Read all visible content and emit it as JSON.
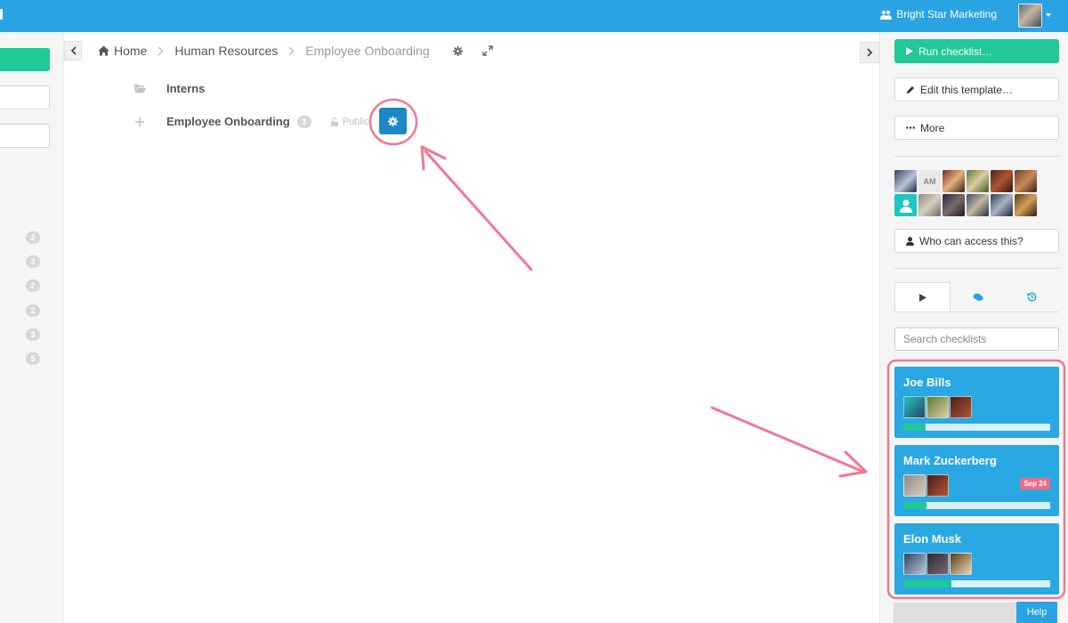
{
  "topbar": {
    "org_name": "Bright Star Marketing",
    "org_icon": "users-icon",
    "accent_color": "#2aa3e3"
  },
  "breadcrumb": {
    "home": "Home",
    "level1": "Human Resources",
    "current": "Employee Onboarding"
  },
  "tree": {
    "folder_name": "Interns",
    "item_name": "Employee Onboarding",
    "item_count": "3",
    "visibility": "Public"
  },
  "left_sidebar": {
    "counts": [
      "2",
      "3",
      "2",
      "2",
      "3",
      "5"
    ]
  },
  "right_panel": {
    "run_label": "Run checklist…",
    "edit_label": "Edit this template…",
    "more_label": "More",
    "access_label": "Who can access this?",
    "avatar_initials": "AM",
    "search_placeholder": "Search checklists",
    "tabs": [
      "play-icon",
      "comments-icon",
      "history-icon"
    ]
  },
  "checklists": [
    {
      "name": "Joe Bills",
      "progress": 0.15
    },
    {
      "name": "Mark Zuckerberg",
      "progress": 0.16,
      "due": "Sep 24"
    },
    {
      "name": "Elon Musk",
      "progress": 0.33
    }
  ],
  "footer": {
    "help_label": "Help"
  },
  "colors": {
    "green": "#20c997",
    "card_blue": "#29a8e4",
    "gear_button": "#1e88c6",
    "due_badge": "#f06a83",
    "annotation": "#f0607e"
  }
}
